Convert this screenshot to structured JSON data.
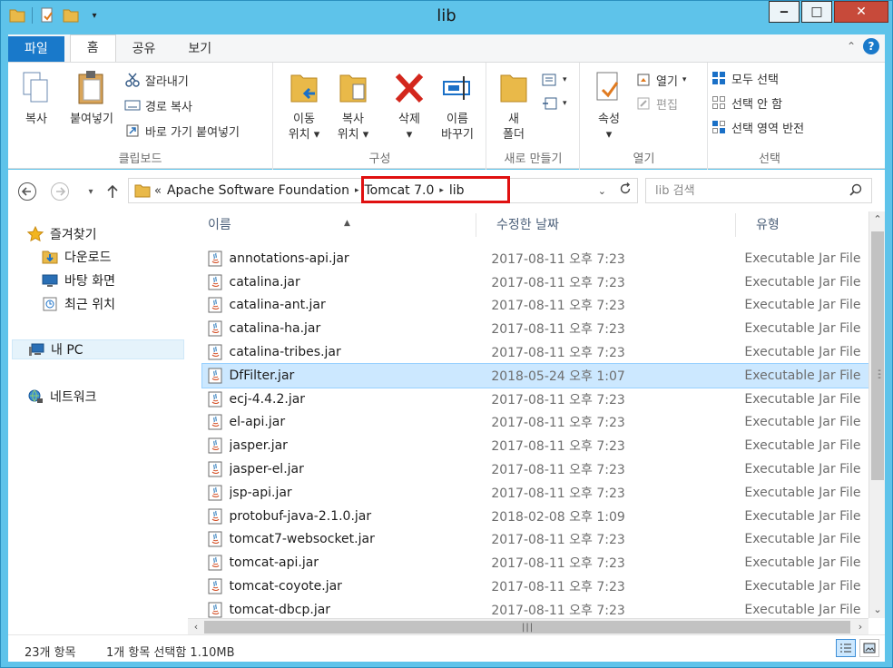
{
  "window": {
    "title": "lib",
    "minimize": "‒",
    "maximize": "□",
    "close": "✕"
  },
  "ribbon_tabs": [
    {
      "label": "파일"
    },
    {
      "label": "홈"
    },
    {
      "label": "공유"
    },
    {
      "label": "보기"
    }
  ],
  "ribbon": {
    "clipboard": {
      "label": "클립보드",
      "copy": "복사",
      "paste": "붙여넣기",
      "cut": "잘라내기",
      "copy_path": "경로 복사",
      "paste_shortcut": "바로 가기 붙여넣기"
    },
    "organize": {
      "label": "구성",
      "move_to_1": "이동",
      "move_to_2": "위치",
      "copy_to_1": "복사",
      "copy_to_2": "위치",
      "delete_1": "삭제",
      "rename_1": "이름",
      "rename_2": "바꾸기"
    },
    "new": {
      "label": "새로 만들기",
      "new_folder_1": "새",
      "new_folder_2": "폴더"
    },
    "open": {
      "label": "열기",
      "properties": "속성",
      "open": "열기",
      "edit": "편집"
    },
    "select": {
      "label": "선택",
      "select_all": "모두 선택",
      "select_none": "선택 안 함",
      "invert": "선택 영역 반전"
    }
  },
  "address_bar": {
    "overflow": "«",
    "crumbs": [
      "Apache Software Foundation",
      "Tomcat 7.0",
      "lib"
    ],
    "search_placeholder": "lib 검색"
  },
  "sidebar": {
    "favorites": "즐겨찾기",
    "downloads": "다운로드",
    "desktop": "바탕 화면",
    "recent": "최근 위치",
    "this_pc": "내 PC",
    "network": "네트워크"
  },
  "columns": {
    "name": "이름",
    "date": "수정한 날짜",
    "type": "유형"
  },
  "files": [
    {
      "name": "annotations-api.jar",
      "date": "2017-08-11 오후 7:23",
      "type": "Executable Jar File"
    },
    {
      "name": "catalina.jar",
      "date": "2017-08-11 오후 7:23",
      "type": "Executable Jar File"
    },
    {
      "name": "catalina-ant.jar",
      "date": "2017-08-11 오후 7:23",
      "type": "Executable Jar File"
    },
    {
      "name": "catalina-ha.jar",
      "date": "2017-08-11 오후 7:23",
      "type": "Executable Jar File"
    },
    {
      "name": "catalina-tribes.jar",
      "date": "2017-08-11 오후 7:23",
      "type": "Executable Jar File"
    },
    {
      "name": "DfFilter.jar",
      "date": "2018-05-24 오후 1:07",
      "type": "Executable Jar File",
      "selected": true
    },
    {
      "name": "ecj-4.4.2.jar",
      "date": "2017-08-11 오후 7:23",
      "type": "Executable Jar File"
    },
    {
      "name": "el-api.jar",
      "date": "2017-08-11 오후 7:23",
      "type": "Executable Jar File"
    },
    {
      "name": "jasper.jar",
      "date": "2017-08-11 오후 7:23",
      "type": "Executable Jar File"
    },
    {
      "name": "jasper-el.jar",
      "date": "2017-08-11 오후 7:23",
      "type": "Executable Jar File"
    },
    {
      "name": "jsp-api.jar",
      "date": "2017-08-11 오후 7:23",
      "type": "Executable Jar File"
    },
    {
      "name": "protobuf-java-2.1.0.jar",
      "date": "2018-02-08 오후 1:09",
      "type": "Executable Jar File"
    },
    {
      "name": "tomcat7-websocket.jar",
      "date": "2017-08-11 오후 7:23",
      "type": "Executable Jar File"
    },
    {
      "name": "tomcat-api.jar",
      "date": "2017-08-11 오후 7:23",
      "type": "Executable Jar File"
    },
    {
      "name": "tomcat-coyote.jar",
      "date": "2017-08-11 오후 7:23",
      "type": "Executable Jar File"
    },
    {
      "name": "tomcat-dbcp.jar",
      "date": "2017-08-11 오후 7:23",
      "type": "Executable Jar File"
    }
  ],
  "status": {
    "item_count": "23개 항목",
    "selection": "1개 항목 선택함 1.10MB"
  }
}
